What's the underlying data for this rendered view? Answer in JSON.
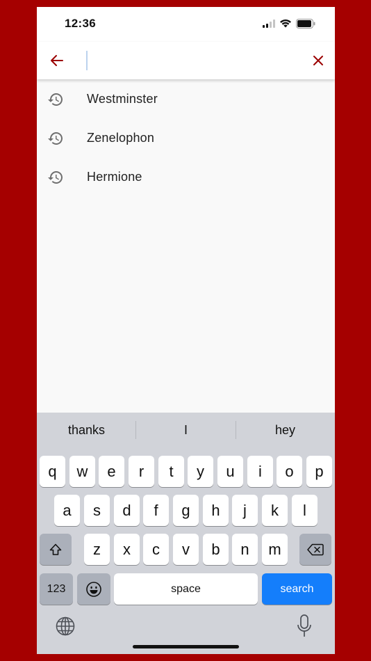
{
  "status_bar": {
    "time": "12:36"
  },
  "search": {
    "value": "",
    "placeholder": ""
  },
  "history": [
    {
      "label": "Westminster",
      "icon": "history-icon"
    },
    {
      "label": "Zenelophon",
      "icon": "history-icon"
    },
    {
      "label": "Hermione",
      "icon": "history-icon"
    }
  ],
  "keyboard": {
    "suggestions": [
      "thanks",
      "I",
      "hey"
    ],
    "row1": [
      "q",
      "w",
      "e",
      "r",
      "t",
      "y",
      "u",
      "i",
      "o",
      "p"
    ],
    "row2": [
      "a",
      "s",
      "d",
      "f",
      "g",
      "h",
      "j",
      "k",
      "l"
    ],
    "row3": [
      "z",
      "x",
      "c",
      "v",
      "b",
      "n",
      "m"
    ],
    "numbers_label": "123",
    "space_label": "space",
    "search_label": "search"
  },
  "colors": {
    "accent": "#9b0000",
    "background": "#a50000",
    "search_key": "#147efb"
  }
}
